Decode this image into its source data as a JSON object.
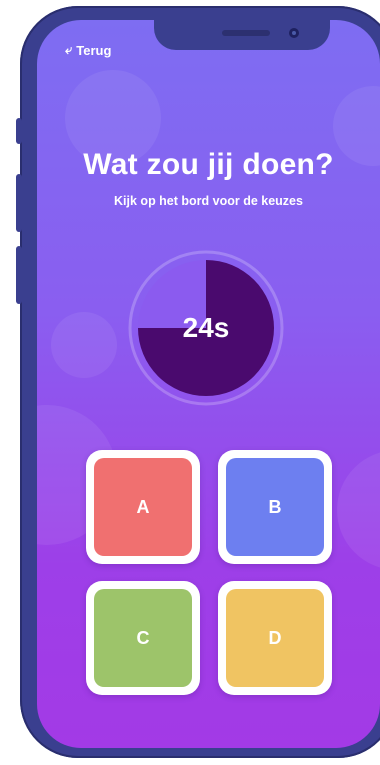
{
  "nav": {
    "back_label": "Terug",
    "back_icon": "back-arrow-icon"
  },
  "question": {
    "title": "Wat zou jij doen?",
    "subtitle": "Kijk op het bord voor de keuzes"
  },
  "timer": {
    "label": "24s",
    "seconds_remaining": 24,
    "remaining_fraction": 0.75
  },
  "answers": [
    {
      "label": "A",
      "color": "#f07070"
    },
    {
      "label": "B",
      "color": "#6d7ff0"
    },
    {
      "label": "C",
      "color": "#9dc46a"
    },
    {
      "label": "D",
      "color": "#f0c462"
    }
  ],
  "colors": {
    "gradient_top": "#7e6df2",
    "gradient_bottom": "#a33ae6",
    "timer_fill": "#4a0a6e",
    "timer_bg": "#8b5bef",
    "phone_frame": "#3a3f8f"
  }
}
